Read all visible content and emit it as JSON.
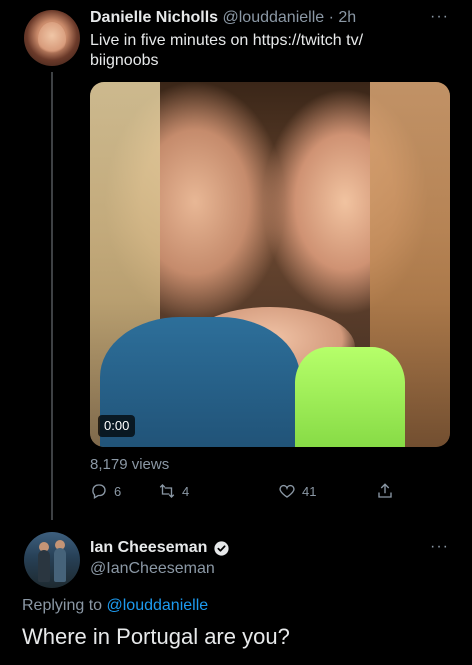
{
  "tweet": {
    "author_name": "Danielle Nicholls",
    "author_handle": "@louddanielle",
    "separator": "·",
    "time": "2h",
    "text": "Live in five minutes on https://twitch tv/ biignoobs",
    "media": {
      "duration": "0:00"
    },
    "views": "8,179 views",
    "actions": {
      "replies": "6",
      "retweets": "4",
      "likes": "41"
    },
    "more_icon": "ellipsis-icon"
  },
  "reply": {
    "author_name": "Ian Cheeseman",
    "author_handle": "@IanCheeseman",
    "verified": true,
    "replying_prefix": "Replying to",
    "replying_to": "@louddanielle",
    "text": "Where in Portugal are you?"
  },
  "colors": {
    "background": "#000000",
    "text_primary": "#e7e9ea",
    "text_secondary": "#8b98a5",
    "link": "#1d9bf0",
    "verified_badge": "#e7e9ea"
  },
  "more_text": "···"
}
